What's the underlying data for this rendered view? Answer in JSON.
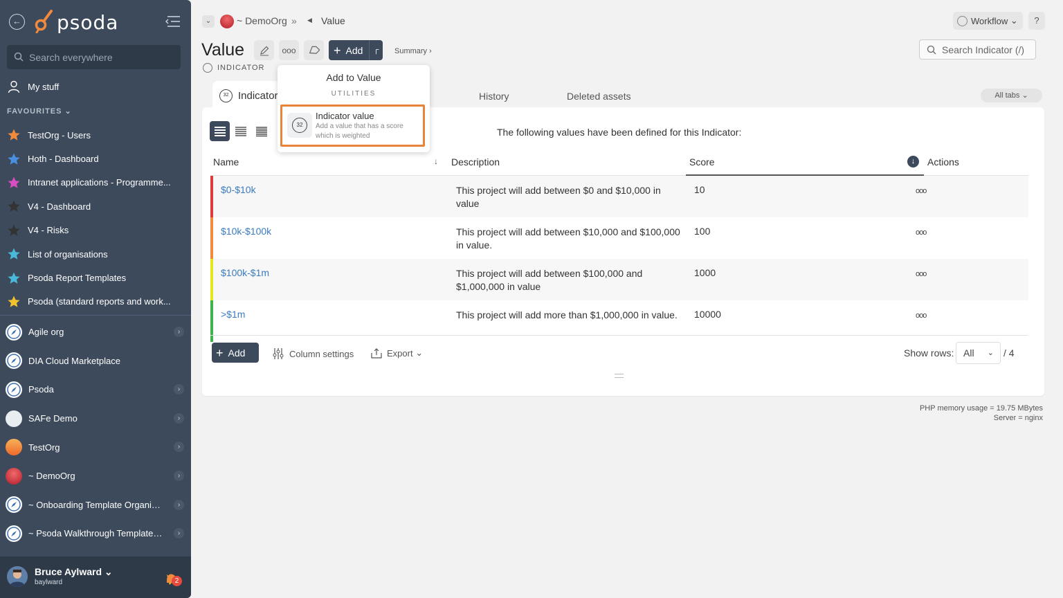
{
  "sidebar": {
    "logo_text": "psoda",
    "search_placeholder": "Search everywhere",
    "my_stuff": "My stuff",
    "favourites_label": "FAVOURITES",
    "favourites": [
      {
        "label": "TestOrg - Users",
        "color": "#f08a3c"
      },
      {
        "label": "Hoth - Dashboard",
        "color": "#4a90e2"
      },
      {
        "label": "Intranet applications - Programme...",
        "color": "#d94cc2"
      },
      {
        "label": "V4 - Dashboard",
        "color": "#333333"
      },
      {
        "label": "V4 - Risks",
        "color": "#333333"
      },
      {
        "label": "List of organisations",
        "color": "#4ab8d9"
      },
      {
        "label": "Psoda Report Templates",
        "color": "#4ab8d9"
      },
      {
        "label": "Psoda (standard reports and work...",
        "color": "#f2c12e"
      }
    ],
    "orgs": [
      {
        "label": "Agile org",
        "chevron": true
      },
      {
        "label": "DIA Cloud Marketplace",
        "chevron": false
      },
      {
        "label": "Psoda",
        "chevron": true
      },
      {
        "label": "SAFe Demo",
        "chevron": true
      },
      {
        "label": "TestOrg",
        "chevron": true
      },
      {
        "label": "~ DemoOrg",
        "chevron": true
      },
      {
        "label": "~ Onboarding Template Organisa...",
        "chevron": true
      },
      {
        "label": "~ Psoda Walkthrough Template P...",
        "chevron": true
      }
    ],
    "user": {
      "name": "Bruce Aylward",
      "handle": "baylward",
      "notifications": "2"
    }
  },
  "breadcrumb": {
    "org": "~ DemoOrg",
    "separator": "»",
    "current": "Value"
  },
  "header": {
    "workflow": "Workflow",
    "help": "?",
    "title": "Value",
    "subtitle": "INDICATOR",
    "add_label": "Add",
    "summary": "Summary ›",
    "search_placeholder": "Search Indicator (/)"
  },
  "tabs": {
    "active": "Indicator",
    "active_icon": "32",
    "others": [
      "History",
      "Deleted assets"
    ],
    "all_tabs": "All tabs"
  },
  "popup": {
    "title": "Add to Value",
    "section": "UTILITIES",
    "item_label": "Indicator value",
    "item_desc": "Add a value that has a score which is weighted",
    "item_icon": "32"
  },
  "table": {
    "intro": "The following values have been defined for this Indicator:",
    "columns": {
      "name": "Name",
      "description": "Description",
      "score": "Score",
      "actions": "Actions"
    },
    "rows": [
      {
        "name": "$0-$10k",
        "description": "This project will add between $0 and $10,000 in value",
        "score": "10",
        "color": "#e03b3b"
      },
      {
        "name": "$10k-$100k",
        "description": "This project will add between $10,000 and $100,000 in value.",
        "score": "100",
        "color": "#f08a3c"
      },
      {
        "name": "$100k-$1m",
        "description": "This project will add between $100,000 and $1,000,000 in value",
        "score": "1000",
        "color": "#e6e61e"
      },
      {
        "name": ">$1m",
        "description": "This project will add more than $1,000,000 in value.",
        "score": "10000",
        "color": "#3cb44b"
      }
    ],
    "actions_glyph": "ooo"
  },
  "footer": {
    "add_label": "Add",
    "column_settings": "Column settings",
    "export": "Export",
    "show_rows_label": "Show rows:",
    "show_rows_value": "All",
    "row_total": "/ 4"
  },
  "server_info": {
    "memory": "PHP memory usage = 19.75 MBytes",
    "server": "Server = nginx"
  }
}
